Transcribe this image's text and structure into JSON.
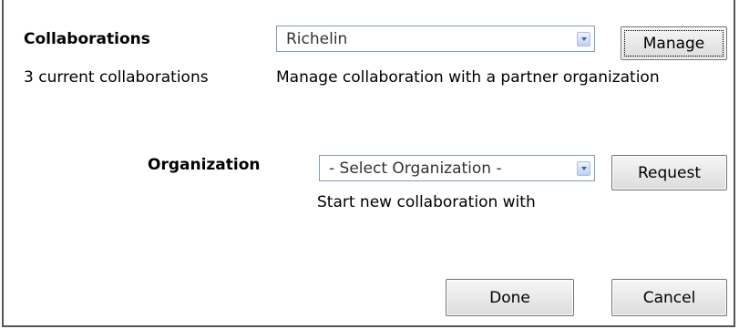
{
  "collaborations": {
    "heading": "Collaborations",
    "count_text": "3 current collaborations",
    "selected": "Richelin",
    "manage_button": "Manage",
    "manage_hint": "Manage collaboration with a partner organization"
  },
  "organization": {
    "label": "Organization",
    "selected": "- Select Organization -",
    "request_button": "Request",
    "request_hint": "Start new collaboration with"
  },
  "footer": {
    "done_button": "Done",
    "cancel_button": "Cancel"
  },
  "icons": {
    "dropdown": "chevron-down-icon"
  },
  "colors": {
    "border": "#555555",
    "select_border": "#7f9db9",
    "button_gradient_top": "#f6f6f6",
    "button_gradient_bottom": "#dcdcdc"
  }
}
